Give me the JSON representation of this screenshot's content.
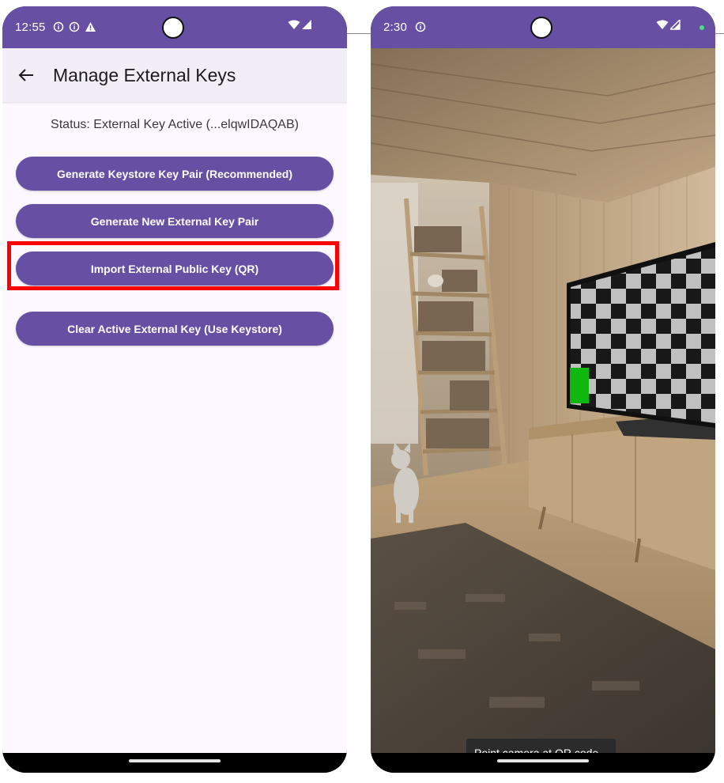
{
  "left_screen": {
    "status_bar": {
      "time": "12:55",
      "icons": [
        "info-circle-icon",
        "info-circle-icon",
        "warning-triangle-icon"
      ]
    },
    "app_bar": {
      "back_icon": "arrow-left-icon",
      "title": "Manage External Keys"
    },
    "status_text": "Status: External Key Active (...elqwIDAQAB)",
    "buttons": [
      {
        "label": "Generate Keystore Key Pair (Recommended)"
      },
      {
        "label": "Generate New External Key Pair"
      },
      {
        "label": "Import External Public Key (QR)",
        "highlighted": true
      },
      {
        "label": "Clear Active External Key (Use Keystore)"
      }
    ]
  },
  "right_screen": {
    "status_bar": {
      "time": "2:30",
      "icons": [
        "info-circle-icon"
      ],
      "indicator_dot_color": "#4ade80"
    },
    "toast": "Point camera at QR code..."
  },
  "colors": {
    "primary": "#6750a4",
    "highlight": "#ff0000",
    "background": "#fdf7ff"
  }
}
